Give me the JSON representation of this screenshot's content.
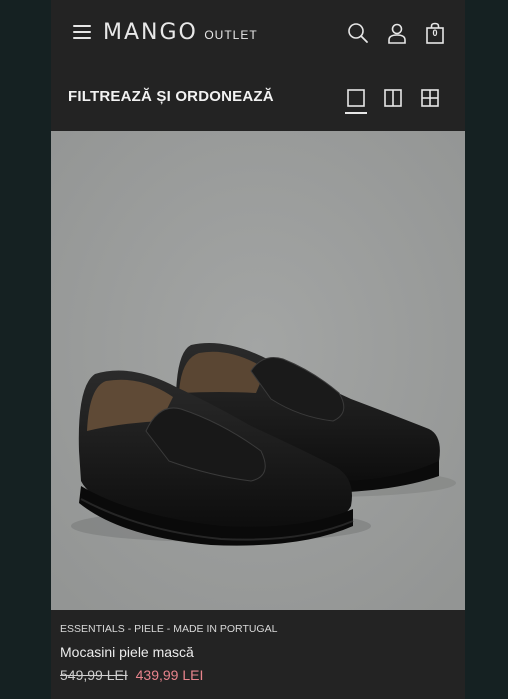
{
  "header": {
    "logo_main": "MANGO",
    "logo_sub": "OUTLET",
    "cart_count": "0"
  },
  "toolbar": {
    "filter_label": "FILTREAZĂ ȘI ORDONEAZĂ"
  },
  "product": {
    "badges": "ESSENTIALS - PIELE - MADE IN PORTUGAL",
    "name": "Mocasini piele mască",
    "old_price": "549,99 LEI",
    "new_price": "439,99 LEI"
  },
  "colors": {
    "page_bg": "#152122",
    "panel_bg": "#232323",
    "image_bg": "#9b9d9c",
    "sale_price": "#e8848c"
  }
}
